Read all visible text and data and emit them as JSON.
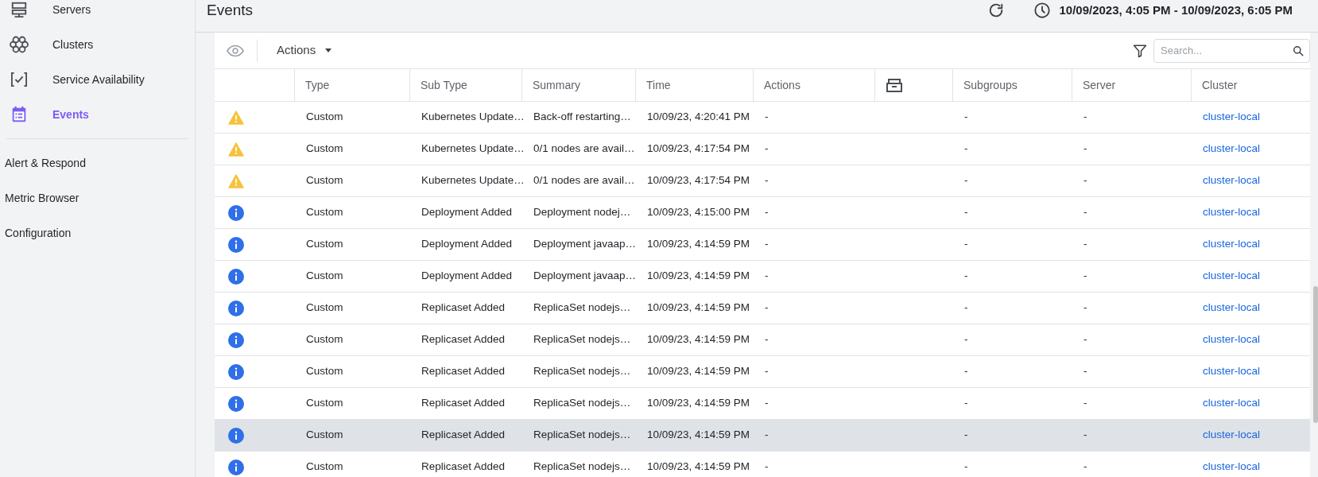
{
  "sidebar": {
    "items": [
      {
        "label": "Servers",
        "kind": "servers",
        "selected": false
      },
      {
        "label": "Clusters",
        "kind": "clusters",
        "selected": false
      },
      {
        "label": "Service Availability",
        "kind": "availability",
        "selected": false
      },
      {
        "label": "Events",
        "kind": "events",
        "selected": true
      }
    ],
    "sections": [
      "Alert & Respond",
      "Metric Browser",
      "Configuration"
    ]
  },
  "page": {
    "title": "Events",
    "time_range": "10/09/2023, 4:05 PM - 10/09/2023, 6:05 PM"
  },
  "toolbar": {
    "actions_label": "Actions",
    "search": {
      "placeholder": "Search..."
    }
  },
  "table": {
    "columns": [
      "Type",
      "Sub Type",
      "Summary",
      "Time",
      "Actions",
      "Subgroups",
      "Server",
      "Cluster"
    ],
    "rows": [
      {
        "kind": "warning",
        "type": "Custom",
        "sub_type": "Kubernetes Update…",
        "summary": "Back-off restarting…",
        "time": "10/09/23, 4:20:41 PM",
        "actions": "-",
        "subgroups": "-",
        "server": "-",
        "cluster": "cluster-local",
        "selected": false
      },
      {
        "kind": "warning",
        "type": "Custom",
        "sub_type": "Kubernetes Update…",
        "summary": "0/1 nodes are avail…",
        "time": "10/09/23, 4:17:54 PM",
        "actions": "-",
        "subgroups": "-",
        "server": "-",
        "cluster": "cluster-local",
        "selected": false
      },
      {
        "kind": "warning",
        "type": "Custom",
        "sub_type": "Kubernetes Update…",
        "summary": "0/1 nodes are avail…",
        "time": "10/09/23, 4:17:54 PM",
        "actions": "-",
        "subgroups": "-",
        "server": "-",
        "cluster": "cluster-local",
        "selected": false
      },
      {
        "kind": "info",
        "type": "Custom",
        "sub_type": "Deployment Added",
        "summary": "Deployment nodej…",
        "time": "10/09/23, 4:15:00 PM",
        "actions": "-",
        "subgroups": "-",
        "server": "-",
        "cluster": "cluster-local",
        "selected": false
      },
      {
        "kind": "info",
        "type": "Custom",
        "sub_type": "Deployment Added",
        "summary": "Deployment javaap…",
        "time": "10/09/23, 4:14:59 PM",
        "actions": "-",
        "subgroups": "-",
        "server": "-",
        "cluster": "cluster-local",
        "selected": false
      },
      {
        "kind": "info",
        "type": "Custom",
        "sub_type": "Deployment Added",
        "summary": "Deployment javaap…",
        "time": "10/09/23, 4:14:59 PM",
        "actions": "-",
        "subgroups": "-",
        "server": "-",
        "cluster": "cluster-local",
        "selected": false
      },
      {
        "kind": "info",
        "type": "Custom",
        "sub_type": "Replicaset Added",
        "summary": "ReplicaSet nodejs…",
        "time": "10/09/23, 4:14:59 PM",
        "actions": "-",
        "subgroups": "-",
        "server": "-",
        "cluster": "cluster-local",
        "selected": false
      },
      {
        "kind": "info",
        "type": "Custom",
        "sub_type": "Replicaset Added",
        "summary": "ReplicaSet nodejs…",
        "time": "10/09/23, 4:14:59 PM",
        "actions": "-",
        "subgroups": "-",
        "server": "-",
        "cluster": "cluster-local",
        "selected": false
      },
      {
        "kind": "info",
        "type": "Custom",
        "sub_type": "Replicaset Added",
        "summary": "ReplicaSet nodejs…",
        "time": "10/09/23, 4:14:59 PM",
        "actions": "-",
        "subgroups": "-",
        "server": "-",
        "cluster": "cluster-local",
        "selected": false
      },
      {
        "kind": "info",
        "type": "Custom",
        "sub_type": "Replicaset Added",
        "summary": "ReplicaSet nodejs…",
        "time": "10/09/23, 4:14:59 PM",
        "actions": "-",
        "subgroups": "-",
        "server": "-",
        "cluster": "cluster-local",
        "selected": false
      },
      {
        "kind": "info",
        "type": "Custom",
        "sub_type": "Replicaset Added",
        "summary": "ReplicaSet nodejs…",
        "time": "10/09/23, 4:14:59 PM",
        "actions": "-",
        "subgroups": "-",
        "server": "-",
        "cluster": "cluster-local",
        "selected": true
      },
      {
        "kind": "info",
        "type": "Custom",
        "sub_type": "Replicaset Added",
        "summary": "ReplicaSet nodejs…",
        "time": "10/09/23, 4:14:59 PM",
        "actions": "-",
        "subgroups": "-",
        "server": "-",
        "cluster": "cluster-local",
        "selected": false
      }
    ]
  }
}
